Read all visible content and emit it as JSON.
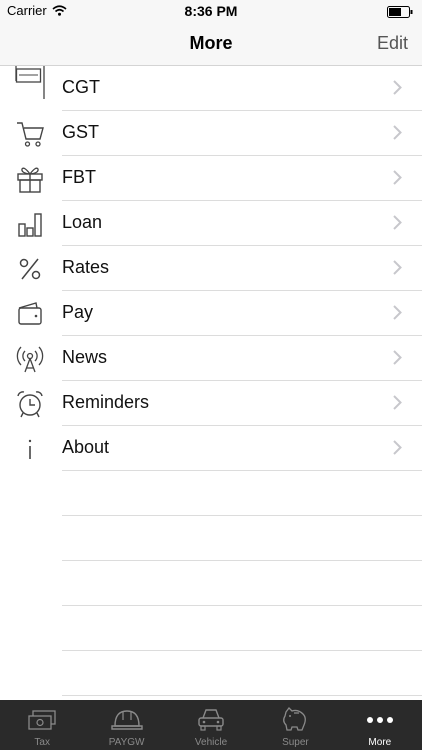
{
  "status_bar": {
    "carrier": "Carrier",
    "time": "8:36 PM",
    "icons": [
      "wifi-icon",
      "battery-icon"
    ]
  },
  "nav": {
    "title": "More",
    "edit_label": "Edit"
  },
  "menu": {
    "items": [
      {
        "label": "CGT",
        "icon": "sign-icon"
      },
      {
        "label": "GST",
        "icon": "cart-icon"
      },
      {
        "label": "FBT",
        "icon": "gift-icon"
      },
      {
        "label": "Loan",
        "icon": "bar-chart-icon"
      },
      {
        "label": "Rates",
        "icon": "percent-icon"
      },
      {
        "label": "Pay",
        "icon": "wallet-icon"
      },
      {
        "label": "News",
        "icon": "antenna-icon"
      },
      {
        "label": "Reminders",
        "icon": "alarm-clock-icon"
      },
      {
        "label": "About",
        "icon": "info-icon"
      }
    ]
  },
  "tabs": {
    "items": [
      {
        "label": "Tax",
        "icon": "banknote-icon"
      },
      {
        "label": "PAYGW",
        "icon": "hard-hat-icon"
      },
      {
        "label": "Vehicle",
        "icon": "car-icon"
      },
      {
        "label": "Super",
        "icon": "piggy-bank-icon"
      },
      {
        "label": "More",
        "icon": "more-dots-icon",
        "active": true
      }
    ]
  },
  "colors": {
    "tab_bar": "#2a2a2a",
    "tab_inactive": "#8a8a8a",
    "tab_active": "#ffffff",
    "separator": "#dcdcdc",
    "chevron": "#c7c7cc"
  }
}
